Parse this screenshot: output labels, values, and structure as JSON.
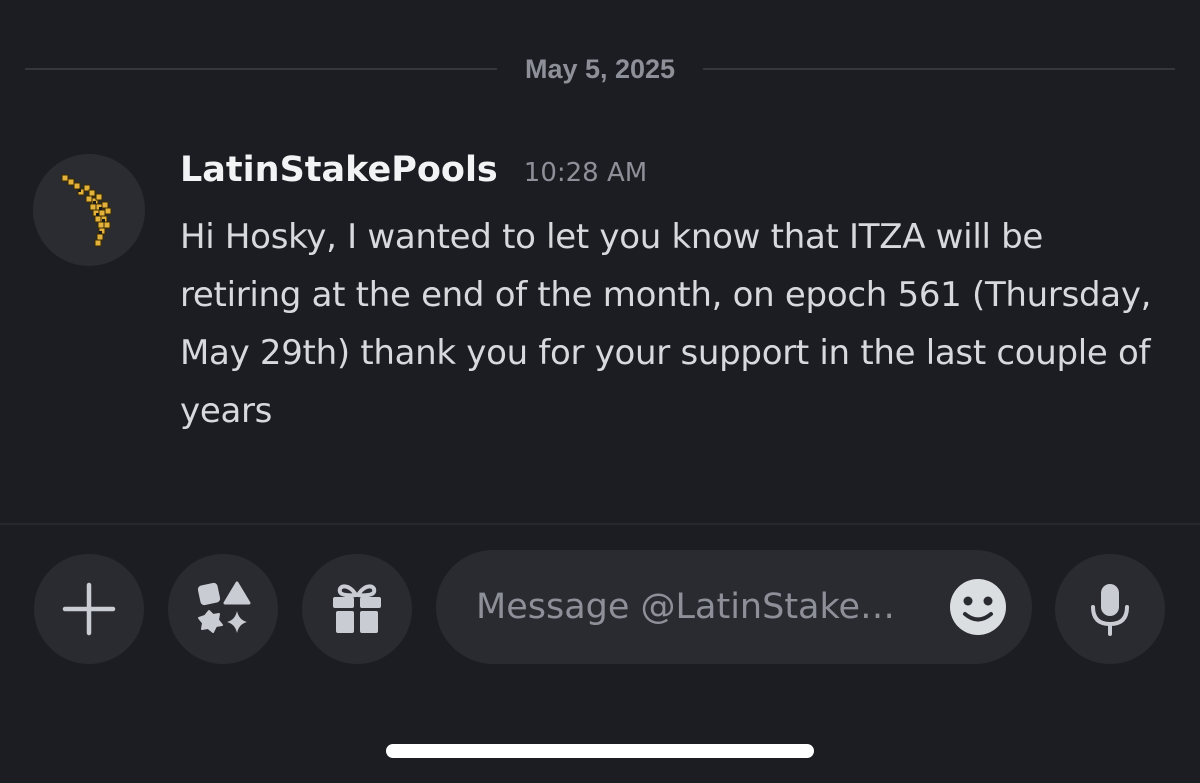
{
  "divider": {
    "date": "May 5, 2025"
  },
  "message": {
    "username": "LatinStakePools",
    "timestamp": "10:28 AM",
    "text": "Hi Hosky, I wanted to let you know that ITZA will be retiring at the end of the month, on epoch 561 (Thursday, May 29th) thank you for your support in the last couple of years",
    "avatar_icon": "latin-america-map-icon"
  },
  "composer": {
    "placeholder": "Message @LatinStake…",
    "buttons": {
      "add": "plus-icon",
      "apps": "apps-icon",
      "gift": "gift-icon",
      "emoji": "emoji-icon",
      "voice": "microphone-icon"
    }
  },
  "colors": {
    "background": "#1c1d22",
    "button": "#2a2b31",
    "muted_text": "#8e9099",
    "avatar_accent": "#e3b23c"
  }
}
